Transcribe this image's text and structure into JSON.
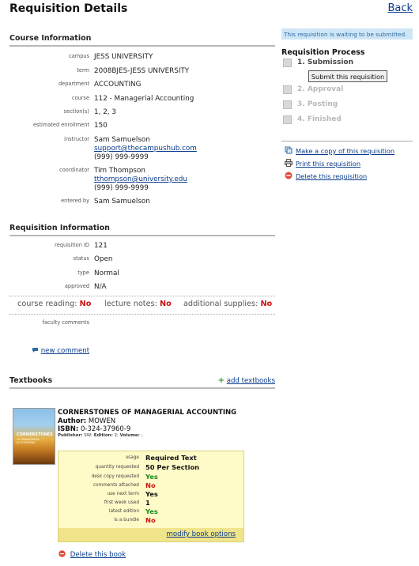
{
  "page": {
    "title": "Requisition Details",
    "back_label": "Back"
  },
  "course": {
    "section_title": "Course Information",
    "campus_label": "campus",
    "campus": "JESS UNIVERSITY",
    "term_label": "term",
    "term": "2008BJES-JESS UNIVERSITY",
    "department_label": "department",
    "department": "ACCOUNTING",
    "course_label": "course",
    "course": "112 - Managerial Accounting",
    "sections_label": "section(s)",
    "sections": "1, 2, 3",
    "enrollment_label": "estimated enrollment",
    "enrollment": "150",
    "instructor_label": "instructor",
    "instructor_name": "Sam Samuelson",
    "instructor_email": "support@thecampushub.com",
    "instructor_phone": "(999) 999-9999",
    "coordinator_label": "coordinator",
    "coordinator_name": "Tim Thompson",
    "coordinator_email": "tthompson@university.edu",
    "coordinator_phone": "(999) 999-9999",
    "entered_by_label": "entered by",
    "entered_by": "Sam Samuelson"
  },
  "requisition": {
    "section_title": "Requisition Information",
    "id_label": "requisition ID",
    "id": "121",
    "status_label": "status",
    "status": "Open",
    "type_label": "type",
    "type": "Normal",
    "approved_label": "approved",
    "approved": "N/A",
    "course_reading_label": "course reading:",
    "course_reading": "No",
    "lecture_notes_label": "lecture notes:",
    "lecture_notes": "No",
    "additional_supplies_label": "additional supplies:",
    "additional_supplies": "No",
    "faculty_comments_label": "faculty comments",
    "new_comment_label": "new comment"
  },
  "sidebar": {
    "notice": "This requisition is waiting to be submitted.",
    "process_title": "Requisition Process",
    "steps": [
      {
        "label": "1. Submission"
      },
      {
        "label": "2. Approval"
      },
      {
        "label": "3. Posting"
      },
      {
        "label": "4. Finished"
      }
    ],
    "submit_label": "Submit this requisition",
    "actions": {
      "copy": "Make a copy of this requisition",
      "print": "Print this requisition",
      "delete": "Delete this requisition"
    }
  },
  "textbooks": {
    "section_title": "Textbooks",
    "add_label": "add textbooks",
    "book": {
      "title": "CORNERSTONES OF MANAGERIAL ACCOUNTING",
      "author_label": "Author:",
      "author": "MOWEN",
      "isbn_label": "ISBN:",
      "isbn": "0-324-37960-9",
      "publisher_label": "Publisher:",
      "publisher": "SW;",
      "edition_label": "Edition:",
      "edition": "2;",
      "volume_label": "Volume:",
      "volume": ";",
      "cover_title": "CORNERSTONES",
      "cover_subtitle": "OF MANAGERIAL ACCOUNTING",
      "options": [
        {
          "label": "usage",
          "value": "Required Text",
          "tone": "dark"
        },
        {
          "label": "quantity requested",
          "value": "50 Per Section",
          "tone": "dark"
        },
        {
          "label": "desk copy requested",
          "value": "Yes",
          "tone": "green"
        },
        {
          "label": "comments attached",
          "value": "No",
          "tone": "red"
        },
        {
          "label": "use next term",
          "value": "Yes",
          "tone": "dark"
        },
        {
          "label": "first week used",
          "value": "1",
          "tone": "dark"
        },
        {
          "label": "latest edition",
          "value": "Yes",
          "tone": "green"
        },
        {
          "label": "is a bundle",
          "value": "No",
          "tone": "red"
        }
      ],
      "modify_label": "modify book options",
      "delete_label": "Delete this book"
    }
  },
  "colors": {
    "link": "#0a3c8c",
    "green": "#1a8a1a",
    "red": "#cc1111",
    "notice_bg": "#cfe6f7",
    "options_bg": "#fffbc8"
  }
}
